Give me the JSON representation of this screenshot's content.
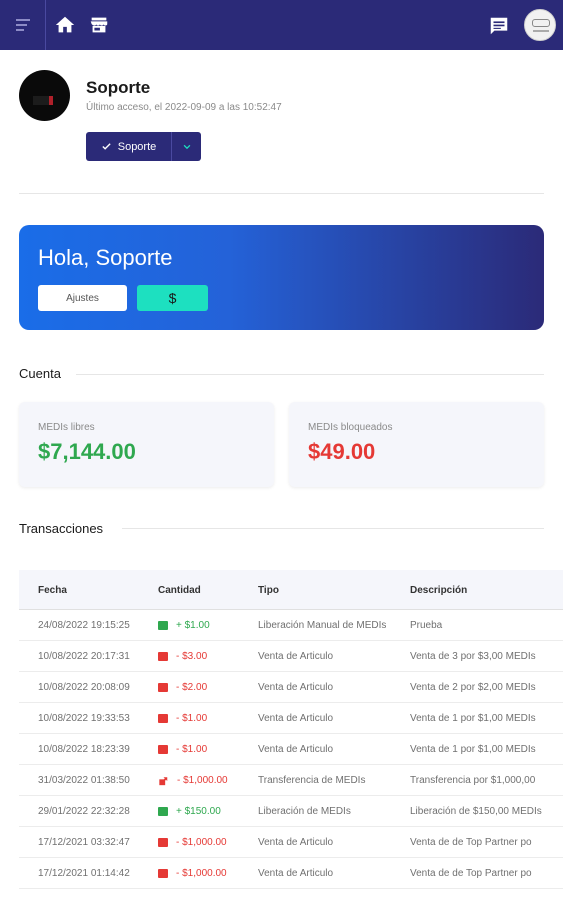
{
  "topbar": {
    "icons": [
      "menu-icon",
      "home-icon",
      "store-icon",
      "chat-icon",
      "account-avatar"
    ],
    "colors": {
      "bar": "#2b2a78"
    }
  },
  "profile": {
    "name": "Soporte",
    "last_access": "Último acceso, el 2022-09-09 a las 10:52:47",
    "role_button": "Soporte"
  },
  "hero": {
    "greeting": "Hola, Soporte",
    "settings_button": "Ajustes",
    "currency_button": "$"
  },
  "account": {
    "section_title": "Cuenta",
    "free_label": "MEDIs libres",
    "free_value": "$7,144.00",
    "locked_label": "MEDIs bloqueados",
    "locked_value": "$49.00",
    "colors": {
      "free": "#2fa84f",
      "locked": "#e53935"
    }
  },
  "transactions": {
    "section_title": "Transacciones",
    "headers": {
      "date": "Fecha",
      "amount": "Cantidad",
      "type": "Tipo",
      "description": "Descripción"
    },
    "rows": [
      {
        "date": "24/08/2022 19:15:25",
        "amount": "+ $1.00",
        "sign": "pos",
        "icon": "money-icon",
        "type": "Liberación Manual de MEDIs",
        "description": "Prueba"
      },
      {
        "date": "10/08/2022 20:17:31",
        "amount": "- $3.00",
        "sign": "neg",
        "icon": "wallet-icon",
        "type": "Venta de Articulo",
        "description": "Venta de 3 por $3,00 MEDIs"
      },
      {
        "date": "10/08/2022 20:08:09",
        "amount": "- $2.00",
        "sign": "neg",
        "icon": "wallet-icon",
        "type": "Venta de Articulo",
        "description": "Venta de 2 por $2,00 MEDIs"
      },
      {
        "date": "10/08/2022 19:33:53",
        "amount": "- $1.00",
        "sign": "neg",
        "icon": "wallet-icon",
        "type": "Venta de Articulo",
        "description": "Venta de 1 por $1,00 MEDIs"
      },
      {
        "date": "10/08/2022 18:23:39",
        "amount": "- $1.00",
        "sign": "neg",
        "icon": "wallet-icon",
        "type": "Venta de Articulo",
        "description": "Venta de 1 por $1,00 MEDIs"
      },
      {
        "date": "31/03/2022 01:38:50",
        "amount": "- $1,000.00",
        "sign": "neg",
        "icon": "share-icon",
        "type": "Transferencia de MEDIs",
        "description": "Transferencia por $1,000,00"
      },
      {
        "date": "29/01/2022 22:32:28",
        "amount": "+ $150.00",
        "sign": "pos",
        "icon": "money-icon",
        "type": "Liberación de MEDIs",
        "description": "Liberación de $150,00 MEDIs"
      },
      {
        "date": "17/12/2021 03:32:47",
        "amount": "- $1,000.00",
        "sign": "neg",
        "icon": "wallet-icon",
        "type": "Venta de Articulo",
        "description": "Venta de de Top Partner po"
      },
      {
        "date": "17/12/2021 01:14:42",
        "amount": "- $1,000.00",
        "sign": "neg",
        "icon": "wallet-icon",
        "type": "Venta de Articulo",
        "description": "Venta de de Top Partner po"
      }
    ]
  }
}
